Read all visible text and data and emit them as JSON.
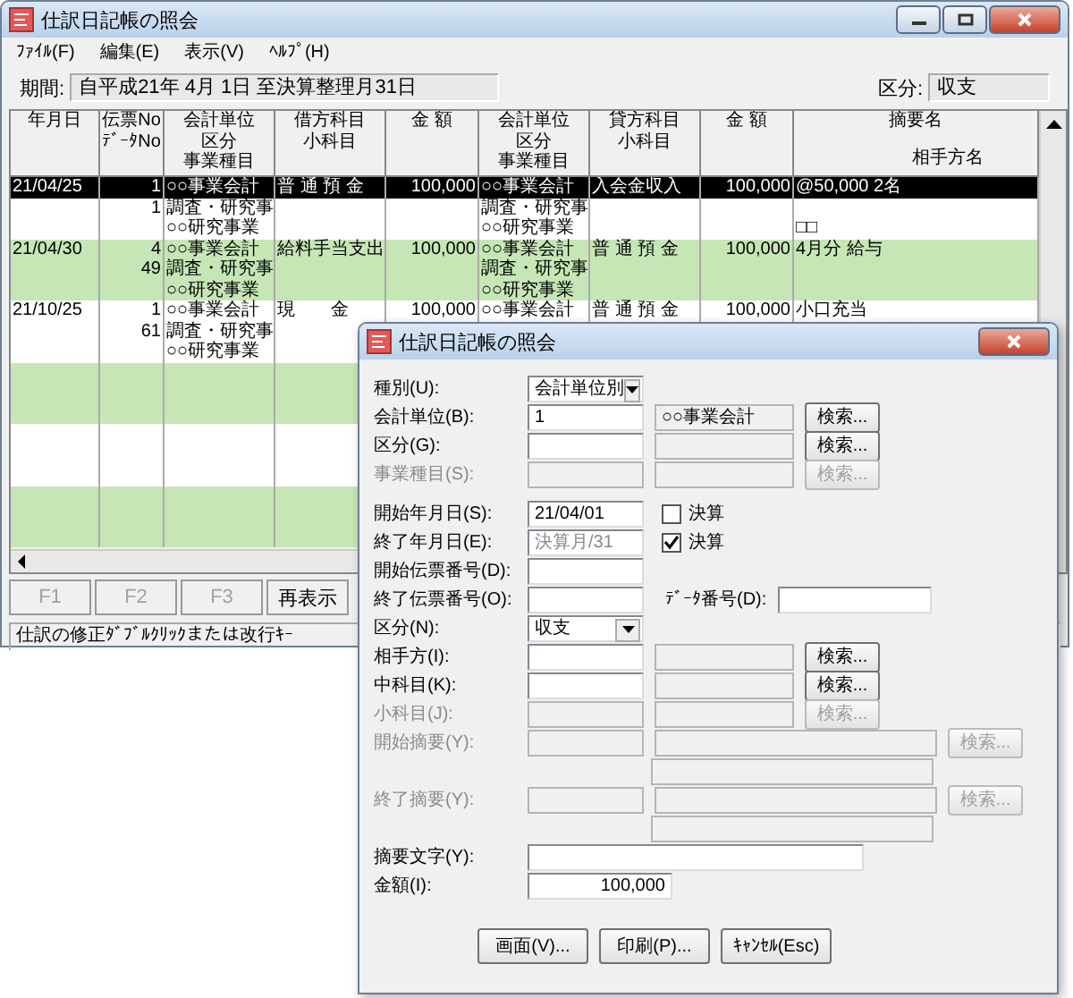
{
  "main_window": {
    "title": "仕訳日記帳の照会",
    "menu": [
      "ﾌｧｲﾙ(F)",
      "編集(E)",
      "表示(V)",
      "ﾍﾙﾌﾟ(H)"
    ],
    "period": {
      "label": "期間:",
      "value": "自平成21年 4月 1日 至決算整理月31日"
    },
    "category": {
      "label": "区分:",
      "value": "収支"
    },
    "table": {
      "columns": [
        {
          "lines": [
            "年月日"
          ]
        },
        {
          "lines": [
            "伝票No",
            "ﾃﾞｰﾀNo"
          ]
        },
        {
          "lines": [
            "会計単位",
            "区分",
            "事業種目"
          ]
        },
        {
          "lines": [
            "借方科目",
            "小科目"
          ]
        },
        {
          "lines": [
            "金 額"
          ]
        },
        {
          "lines": [
            "会計単位",
            "区分",
            "事業種目"
          ]
        },
        {
          "lines": [
            "貸方科目",
            "小科目"
          ]
        },
        {
          "lines": [
            "金 額"
          ]
        },
        {
          "lines": [
            "摘要名",
            "相手方名"
          ]
        }
      ],
      "entries": [
        {
          "selected": true,
          "shaded": false,
          "lines": [
            {
              "date": "21/04/25",
              "no": "1",
              "unit": "○○事業会計",
              "debit": "普 通 預 金",
              "debit_amount": "100,000",
              "credit_unit": "○○事業会計",
              "credit": "入会金収入",
              "credit_amount": "100,000",
              "memo": "@50,000 2名"
            },
            {
              "no": "1",
              "unit": "調査・研究事",
              "credit_unit": "調査・研究事"
            },
            {
              "unit": "○○研究事業",
              "credit_unit": "○○研究事業",
              "memo": "□□"
            }
          ]
        },
        {
          "selected": false,
          "shaded": true,
          "lines": [
            {
              "date": "21/04/30",
              "no": "4",
              "unit": "○○事業会計",
              "debit": "給料手当支出",
              "debit_amount": "100,000",
              "credit_unit": "○○事業会計",
              "credit": "普 通 預 金",
              "credit_amount": "100,000",
              "memo": "4月分 給与"
            },
            {
              "no": "49",
              "unit": "調査・研究事",
              "credit_unit": "調査・研究事"
            },
            {
              "unit": "○○研究事業",
              "credit_unit": "○○研究事業"
            }
          ]
        },
        {
          "selected": false,
          "shaded": false,
          "lines": [
            {
              "date": "21/10/25",
              "no": "1",
              "unit": "○○事業会計",
              "debit": "現　　金",
              "debit_amount": "100,000",
              "credit_unit": "○○事業会計",
              "credit": "普 通 預 金",
              "credit_amount": "100,000",
              "memo": "小口充当"
            },
            {
              "no": "61",
              "unit": "調査・研究事"
            },
            {
              "unit": "○○研究事業"
            }
          ]
        }
      ],
      "empty_rows": [
        {
          "shaded": true
        },
        {
          "shaded": false
        },
        {
          "shaded": true
        }
      ]
    },
    "buttons": [
      {
        "label": "F1",
        "disabled": true
      },
      {
        "label": "F2",
        "disabled": true
      },
      {
        "label": "F3",
        "disabled": true
      },
      {
        "label": "再表示",
        "disabled": false
      }
    ],
    "status_bar": "仕訳の修正ﾀﾞﾌﾞﾙｸﾘｯｸまたは改行ｷｰ"
  },
  "dialog": {
    "title": "仕訳日記帳の照会",
    "groups": [
      [
        {
          "kind": "select",
          "label": "種別(U):",
          "value": "会計単位別",
          "disabled": false
        },
        {
          "kind": "lookup",
          "label": "会計単位(B):",
          "value": "1",
          "display": "○○事業会計",
          "button": "検索...",
          "disabled": false
        },
        {
          "kind": "lookup",
          "label": "区分(G):",
          "button": "検索...",
          "disabled": false
        },
        {
          "kind": "lookup",
          "label": "事業種目(S):",
          "button": "検索...",
          "disabled": true
        }
      ],
      [
        {
          "kind": "date",
          "label": "開始年月日(S):",
          "value": "21/04/01",
          "greyed": false,
          "check": {
            "label": "決算",
            "checked": false
          }
        },
        {
          "kind": "date",
          "label": "終了年月日(E):",
          "value": "決算月/31",
          "greyed": true,
          "check": {
            "label": "決算",
            "checked": true
          }
        },
        {
          "kind": "input",
          "label": "開始伝票番号(D):"
        },
        {
          "kind": "input",
          "label": "終了伝票番号(O):",
          "extra": {
            "label": "ﾃﾞｰﾀ番号(D):"
          }
        },
        {
          "kind": "select",
          "label": "区分(N):",
          "value": "収支",
          "disabled": false
        },
        {
          "kind": "lookup",
          "label": "相手方(I):",
          "button": "検索...",
          "disabled": false
        },
        {
          "kind": "lookup",
          "label": "中科目(K):",
          "button": "検索...",
          "disabled": false
        },
        {
          "kind": "lookup",
          "label": "小科目(J):",
          "button": "検索...",
          "disabled": true
        },
        {
          "kind": "memo",
          "label": "開始摘要(Y):",
          "button": "検索...",
          "disabled": true,
          "second_line": true
        },
        {
          "kind": "memo",
          "label": "終了摘要(Y):",
          "button": "検索...",
          "disabled": true,
          "second_line": true
        },
        {
          "kind": "text",
          "label": "摘要文字(Y):"
        },
        {
          "kind": "amount",
          "label": "金額(I):",
          "value": "100,000"
        }
      ]
    ],
    "buttons": [
      "画面(V)...",
      "印刷(P)...",
      "ｷｬﾝｾﾙ(Esc)"
    ]
  }
}
